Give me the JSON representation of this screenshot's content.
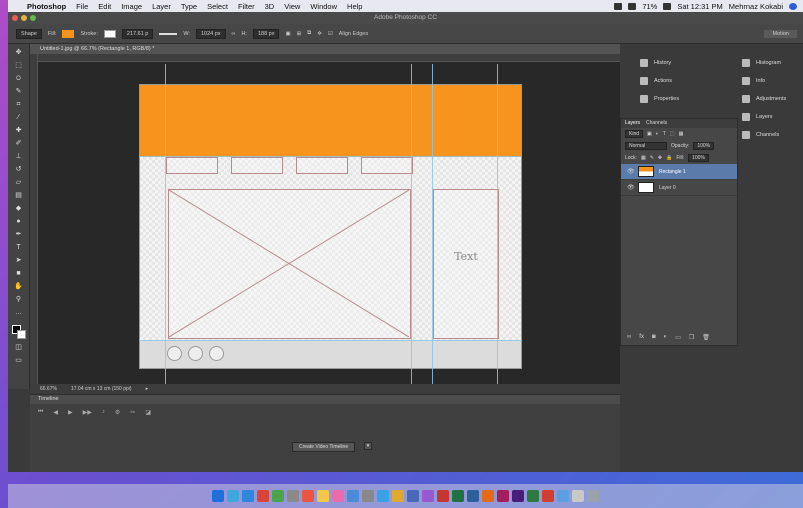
{
  "menubar": {
    "app_name": "Photoshop",
    "items": [
      "File",
      "Edit",
      "Image",
      "Layer",
      "Type",
      "Select",
      "Filter",
      "3D",
      "View",
      "Window",
      "Help"
    ],
    "battery": "71%",
    "clock": "Sat 12:31 PM",
    "user": "Mehrnaz Kokabi"
  },
  "window": {
    "title": "Adobe Photoshop CC"
  },
  "options": {
    "shape_mode": "Shape",
    "fill_label": "Fill:",
    "stroke_label": "Stroke:",
    "stroke_width": "217.61 p",
    "w_label": "W:",
    "w_value": "1024 px",
    "h_label": "H:",
    "h_value": "188 px",
    "align_edges": "Align Edges",
    "workspace": "Motion",
    "fill_color": "#f7941d"
  },
  "document": {
    "tab_title": "Untitled-1.jpg @ 66.7% (Rectangle 1, RGB/8) *",
    "canvas_text": "Text",
    "zoom": "66.67%",
    "doc_size": "17.04 cm x 13 cm (150 ppi)"
  },
  "timeline": {
    "title": "Timeline",
    "create_button": "Create Video Timeline"
  },
  "panels": {
    "mini_left": [
      {
        "label": "History",
        "icon": "history-icon"
      },
      {
        "label": "Actions",
        "icon": "actions-icon"
      },
      {
        "label": "Properties",
        "icon": "properties-icon"
      }
    ],
    "mini_right": [
      {
        "label": "Histogram",
        "icon": "histogram-icon"
      },
      {
        "label": "Info",
        "icon": "info-icon"
      },
      {
        "label": "Adjustments",
        "icon": "adjustments-icon"
      },
      {
        "label": "Layers",
        "icon": "layers-icon"
      },
      {
        "label": "Channels",
        "icon": "channels-icon"
      }
    ]
  },
  "layers": {
    "tab_layers": "Layers",
    "tab_channels": "Channels",
    "kind": "Kind",
    "blend_mode": "Normal",
    "opacity_label": "Opacity:",
    "opacity_value": "100%",
    "lock_label": "Lock:",
    "fill_label": "Fill:",
    "fill_value": "100%",
    "items": [
      {
        "name": "Rectangle 1",
        "selected": true
      },
      {
        "name": "Layer 0",
        "selected": false
      }
    ]
  }
}
